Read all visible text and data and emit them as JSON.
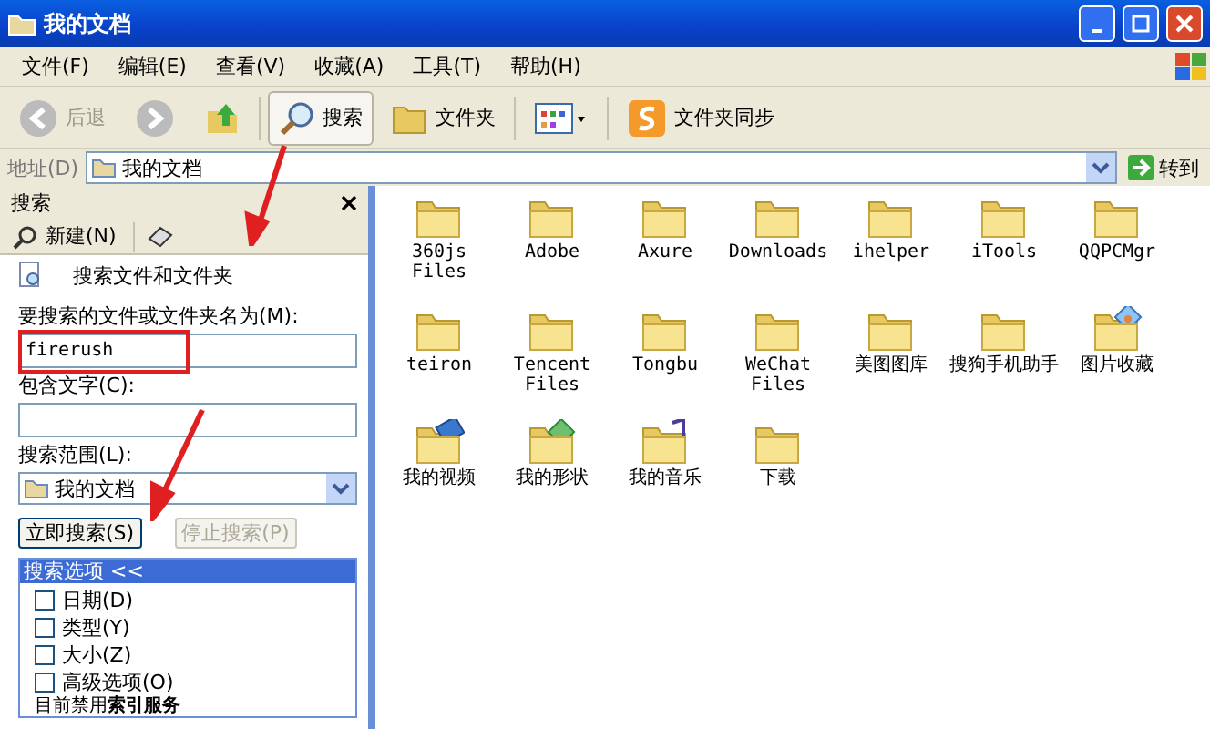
{
  "window": {
    "title": "我的文档"
  },
  "menu": [
    "文件(F)",
    "编辑(E)",
    "查看(V)",
    "收藏(A)",
    "工具(T)",
    "帮助(H)"
  ],
  "toolbar": [
    {
      "kind": "back",
      "label": "后退",
      "disabled": true
    },
    {
      "kind": "forward",
      "disabled": true
    },
    {
      "kind": "up",
      "disabled": false
    },
    {
      "kind": "search",
      "label": "搜索",
      "selected": true
    },
    {
      "kind": "folders",
      "label": "文件夹",
      "selected": false
    },
    {
      "kind": "views",
      "selected": false
    },
    {
      "kind": "sync",
      "label": "文件夹同步",
      "selected": false
    }
  ],
  "address": {
    "label": "地址(D)",
    "value": "我的文档",
    "go": "转到"
  },
  "search_pane": {
    "title": "搜索",
    "new_label": "新建(N)",
    "heading": "搜索文件和文件夹",
    "name_label": "要搜索的文件或文件夹名为(M):",
    "name_value": "firerush",
    "text_label": "包含文字(C):",
    "scope_label": "搜索范围(L):",
    "scope_value": "我的文档",
    "search_button": "立即搜索(S)",
    "stop_button": {
      "label": "停止搜索(P)",
      "disabled": true
    },
    "options_title": "搜索选项 <<",
    "options": [
      {
        "label": "日期(D)",
        "checked": false
      },
      {
        "label": "类型(Y)",
        "checked": false
      },
      {
        "label": "大小(Z)",
        "checked": false
      },
      {
        "label": "高级选项(O)",
        "checked": false
      }
    ],
    "footer": "目前禁用**索引服务**"
  },
  "files": [
    {
      "name": "360js Files",
      "kind": "folder"
    },
    {
      "name": "Adobe",
      "kind": "folder"
    },
    {
      "name": "Axure",
      "kind": "folder"
    },
    {
      "name": "Downloads",
      "kind": "folder"
    },
    {
      "name": "ihelper",
      "kind": "folder"
    },
    {
      "name": "iTools",
      "kind": "folder"
    },
    {
      "name": "QQPCMgr",
      "kind": "folder"
    },
    {
      "name": "teiron",
      "kind": "folder"
    },
    {
      "name": "Tencent Files",
      "kind": "folder"
    },
    {
      "name": "Tongbu",
      "kind": "folder"
    },
    {
      "name": "WeChat Files",
      "kind": "folder"
    },
    {
      "name": "美图图库",
      "kind": "folder"
    },
    {
      "name": "搜狗手机助手",
      "kind": "folder"
    },
    {
      "name": "图片收藏",
      "kind": "pictures"
    },
    {
      "name": "我的视频",
      "kind": "video"
    },
    {
      "name": "我的形状",
      "kind": "shapes"
    },
    {
      "name": "我的音乐",
      "kind": "music"
    },
    {
      "name": "下载",
      "kind": "folder"
    }
  ]
}
